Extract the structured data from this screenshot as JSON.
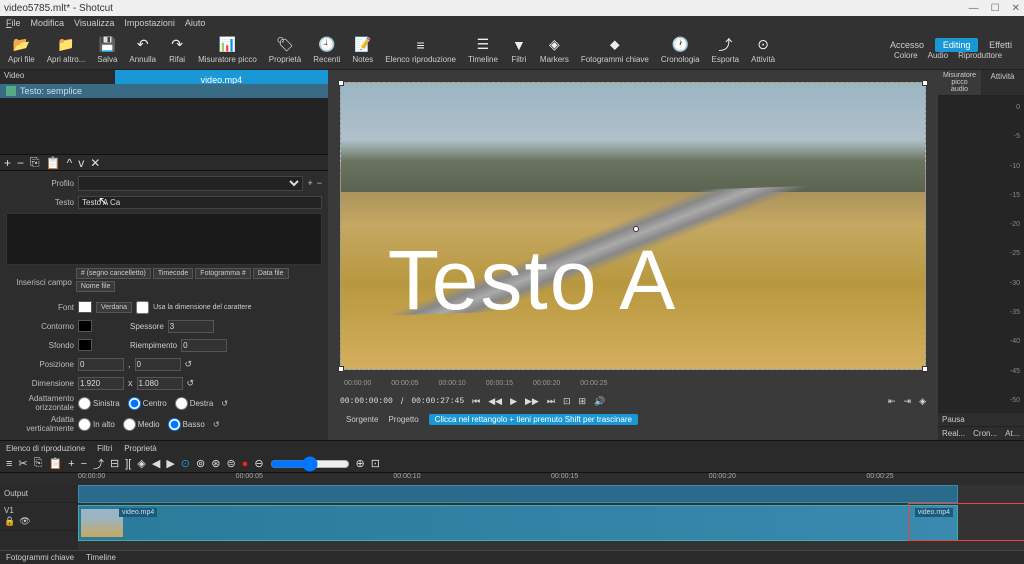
{
  "titlebar": {
    "title": "video5785.mlt* - Shotcut"
  },
  "menubar": [
    "File",
    "Modifica",
    "Visualizza",
    "Impostazioni",
    "Aiuto"
  ],
  "toolbar": {
    "items": [
      {
        "icon": "📂",
        "label": "Apri file"
      },
      {
        "icon": "📁",
        "label": "Apri altro..."
      },
      {
        "icon": "💾",
        "label": "Salva"
      },
      {
        "icon": "↶",
        "label": "Annulla"
      },
      {
        "icon": "↷",
        "label": "Rifai"
      },
      {
        "icon": "📊",
        "label": "Misuratore picco"
      },
      {
        "icon": "🏷",
        "label": "Proprietà"
      },
      {
        "icon": "🕘",
        "label": "Recenti"
      },
      {
        "icon": "📝",
        "label": "Notes"
      },
      {
        "icon": "≡",
        "label": "Elenco riproduzione"
      },
      {
        "icon": "☰",
        "label": "Timeline"
      },
      {
        "icon": "▼",
        "label": "Filtri"
      },
      {
        "icon": "◈",
        "label": "Markers"
      },
      {
        "icon": "⬥",
        "label": "Fotogrammi chiave"
      },
      {
        "icon": "🕐",
        "label": "Cronologia"
      },
      {
        "icon": "⤴",
        "label": "Esporta"
      },
      {
        "icon": "⊙",
        "label": "Attività"
      }
    ],
    "modes": {
      "access": "Accesso",
      "editing": "Editing",
      "effects": "Effetti"
    },
    "subs": [
      "Colore",
      "Audio",
      "Riproduttore"
    ]
  },
  "left": {
    "track_label": "Video",
    "clip_tab": "video.mp4",
    "filter_name": "Testo: semplice",
    "profile_label": "Profilo",
    "text_label": "Testo",
    "text_value": "Testo A Ca",
    "insert_label": "Inserisci campo",
    "insert_buttons": [
      "# (segno cancelletto)",
      "Timecode",
      "Fotogramma #",
      "Data file",
      "Nome file"
    ],
    "font_label": "Font",
    "font_name": "Verdana",
    "use_font_size": "Usa la dimensione del carattere",
    "outline_label": "Contorno",
    "thickness_label": "Spessore",
    "thickness_val": "3",
    "bg_label": "Sfondo",
    "padding_label": "Riempimento",
    "padding_val": "0",
    "position_label": "Posizione",
    "pos_x": "0",
    "pos_y": "0",
    "size_label": "Dimensione",
    "size_w": "1.920",
    "size_h": "1.080",
    "halign_label": "Adattamento orizzontale",
    "halign_opts": [
      "Sinistra",
      "Centro",
      "Destra"
    ],
    "valign_label": "Adatta verticalmente",
    "valign_opts": [
      "In alto",
      "Medio",
      "Basso"
    ]
  },
  "preview": {
    "overlay_text": "Testo A",
    "marks": [
      "00:00:00",
      "00:00:05",
      "00:00:10",
      "00:00:15",
      "00:00:20",
      "00:00:25"
    ],
    "tc_current": "00:00:00:00",
    "tc_total": "00:00:27:45",
    "source": "Sorgente",
    "project": "Progetto",
    "hint": "Clicca nel rettangolo + tieni premuto Shift per trascinare"
  },
  "right": {
    "tab1": "Misuratore picco audio",
    "tab2": "Attività",
    "scale": [
      "0",
      "-5",
      "-10",
      "-15",
      "-20",
      "-25",
      "-30",
      "-35",
      "-40",
      "-45",
      "-50"
    ],
    "pause": "Pausa",
    "real": "Real...",
    "cron": "Cron...",
    "at": "At..."
  },
  "bottom_tabs": [
    "Elenco di riproduzione",
    "Filtri",
    "Proprietà"
  ],
  "timeline": {
    "output": "Output",
    "ruler": [
      "00:00:00",
      "00:00:05",
      "00:00:10",
      "00:00:15",
      "00:00:20",
      "00:00:25"
    ],
    "track_v1": "V1",
    "clip_name": "video.mp4"
  },
  "footer": [
    "Fotogrammi chiave",
    "Timeline"
  ]
}
